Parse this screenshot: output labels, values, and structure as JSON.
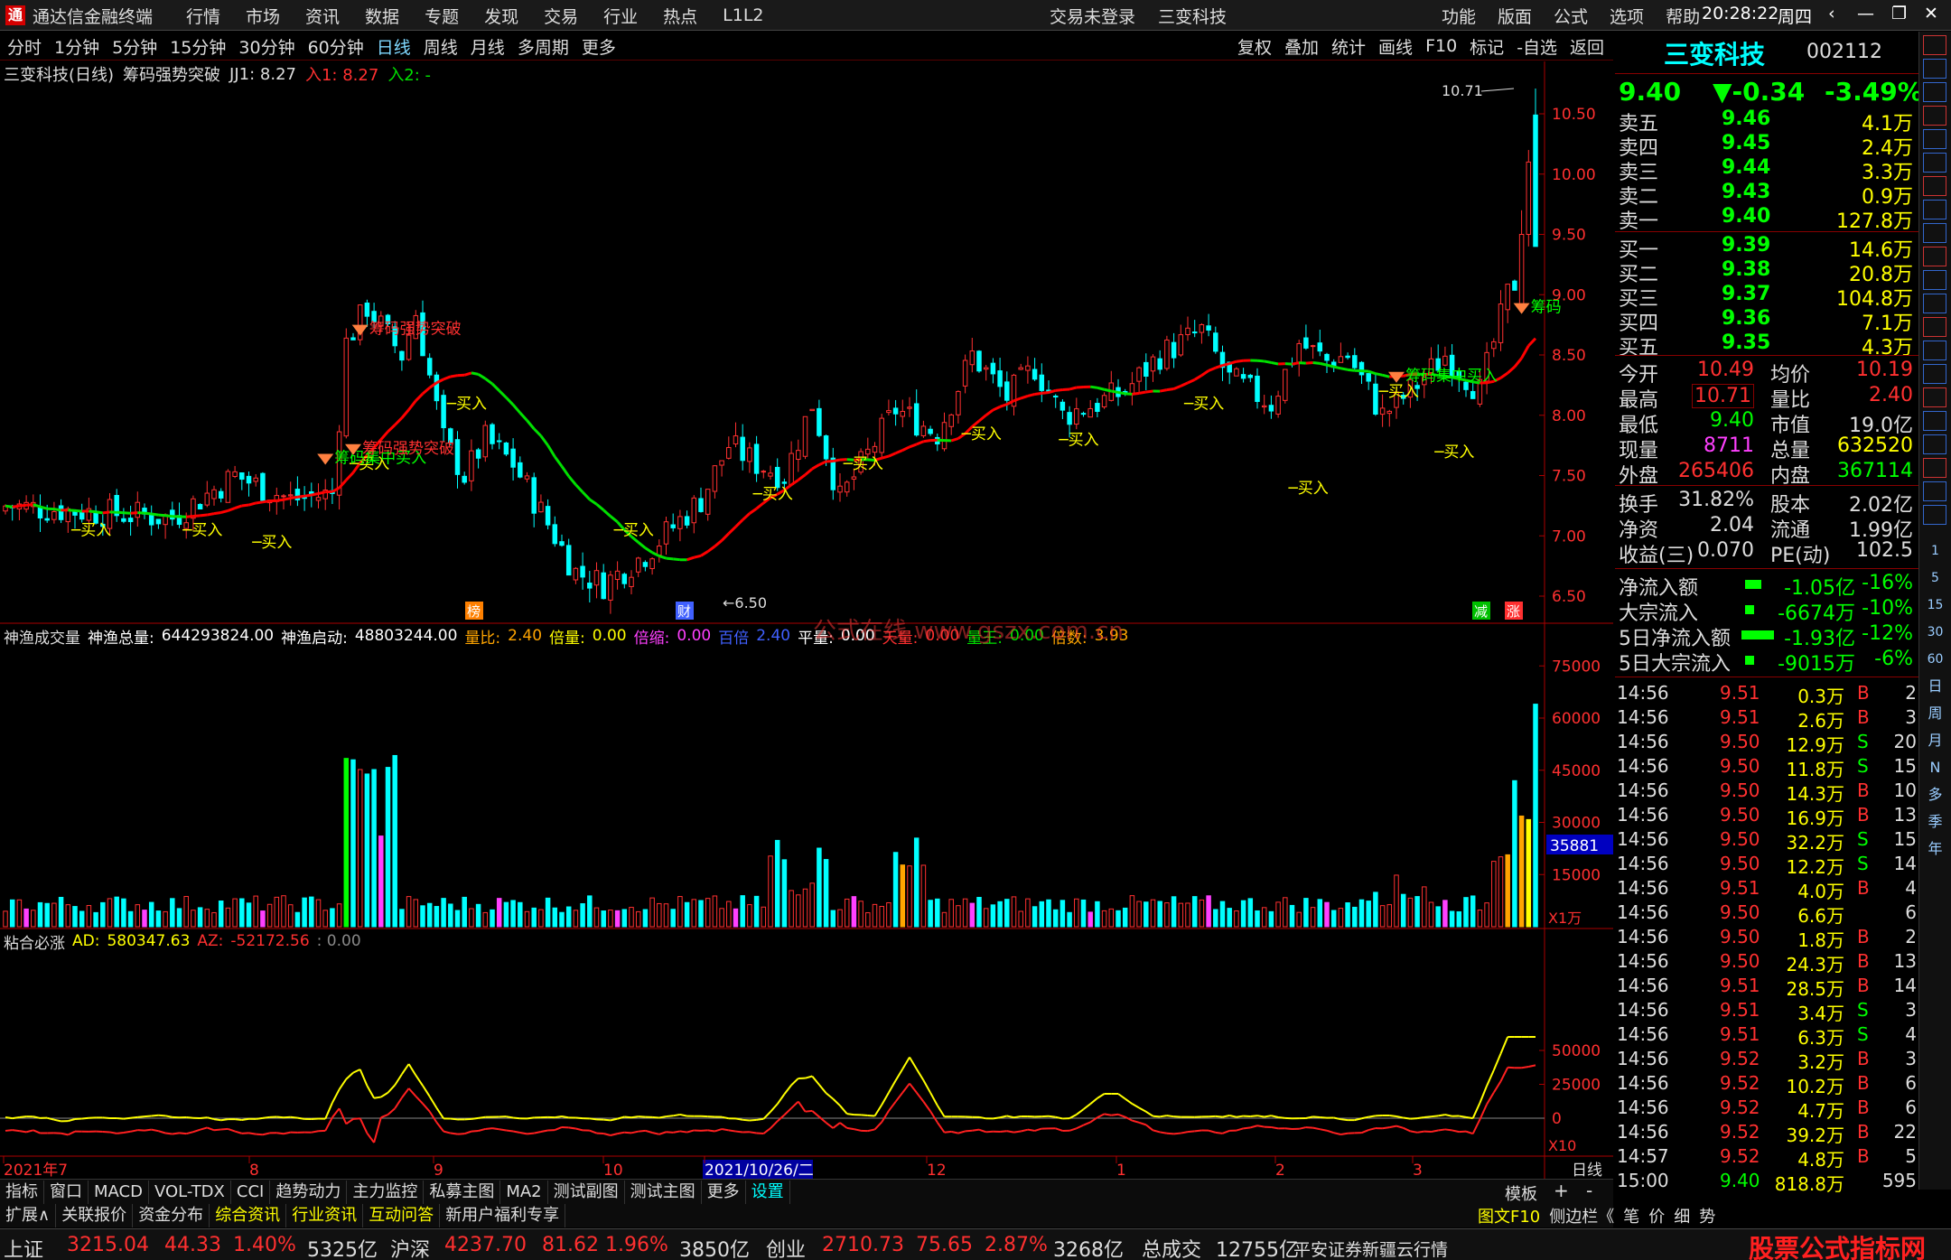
{
  "titlebar": {
    "app": "通达信金融终端",
    "menu": [
      "行情",
      "市场",
      "资讯",
      "数据",
      "专题",
      "发现",
      "交易",
      "行业",
      "热点",
      "L1L2"
    ],
    "center": [
      "交易未登录",
      "三变科技"
    ],
    "right": [
      "功能",
      "版面",
      "公式",
      "选项",
      "帮助"
    ],
    "time": "20:28:22",
    "weekday": "周四"
  },
  "periods": [
    "分时",
    "1分钟",
    "5分钟",
    "15分钟",
    "30分钟",
    "60分钟",
    "日线",
    "周线",
    "月线",
    "多周期",
    "更多"
  ],
  "active_period": "日线",
  "toolbar": [
    "复权",
    "叠加",
    "统计",
    "画线",
    "F10",
    "标记",
    "-自选",
    "返回"
  ],
  "main": {
    "title": "三变科技(日线)",
    "indicator": "筹码强势突破",
    "jj1": "JJ1: 8.27",
    "in1": "入1: 8.27",
    "in2": "入2: -",
    "high_label": "10.71",
    "low_label": "6.50",
    "yticks": [
      "10.50",
      "10.00",
      "9.50",
      "9.00",
      "8.50",
      "8.00",
      "7.50",
      "7.00",
      "6.50"
    ],
    "markers": {
      "bang": "榜",
      "cai": "财",
      "jian": "减",
      "zhang": "涨"
    },
    "labels": [
      "买入",
      "筹码强势突破",
      "筹码集中买入",
      "筹码集中买入",
      "筹码"
    ]
  },
  "vol": {
    "title": "神渔成交量",
    "total_label": "神渔总量:",
    "total": "644293824.00",
    "start_label": "神渔启动:",
    "start": "48803244.00",
    "ratio_label": "量比:",
    "ratio": "2.40",
    "bei_label": "倍量:",
    "bei": "0.00",
    "suo_label": "倍缩:",
    "suo": "0.00",
    "zhi_label": "百倍",
    "zhi": "2.40",
    "ping_label": "平量:",
    "ping": "0.00",
    "tian_label": "天量:",
    "tian": "0.00",
    "wang_label": "量王:",
    "wang": "0.00",
    "beishu_label": "倍数:",
    "beishu": "3.93",
    "yticks": [
      "75000",
      "60000",
      "45000",
      "30000",
      "15000"
    ],
    "cursor_value": "35881",
    "unit": "X1万",
    "watermark": "公式在线 www.gszx.com.cn"
  },
  "osc": {
    "title": "粘合必涨",
    "ad_label": "AD:",
    "ad": "580347.63",
    "az_label": "AZ:",
    "az": "-52172.56",
    "zero_label": ": 0.00",
    "yticks": [
      "50000",
      "25000",
      "0"
    ],
    "unit": "X10"
  },
  "xaxis": {
    "labels": [
      "2021年7",
      "8",
      "9",
      "10",
      "2021/10/26/二",
      "12",
      "1",
      "2",
      "3"
    ],
    "right": "日线"
  },
  "tabs1": [
    "指标",
    "窗口",
    "MACD",
    "VOL-TDX",
    "CCI",
    "趋势动力",
    "主力监控",
    "私募主图",
    "MA2",
    "测试副图",
    "测试主图",
    "更多",
    "设置"
  ],
  "tabs1_right": "模板",
  "tabs2": [
    "扩展∧",
    "关联报价",
    "资金分布",
    "综合资讯",
    "行业资讯",
    "互动问答",
    "新用户福利专享"
  ],
  "tabs2_right": [
    "图文F10",
    "侧边栏《",
    "笔",
    "价",
    "细",
    "势"
  ],
  "quote": {
    "name": "三变科技",
    "code": "002112",
    "price": "9.40",
    "change": "▼-0.34",
    "pct": "-3.49%",
    "sells": [
      [
        "卖五",
        "9.46",
        "4.1万"
      ],
      [
        "卖四",
        "9.45",
        "2.4万"
      ],
      [
        "卖三",
        "9.44",
        "3.3万"
      ],
      [
        "卖二",
        "9.43",
        "0.9万"
      ],
      [
        "卖一",
        "9.40",
        "127.8万"
      ]
    ],
    "buys": [
      [
        "买一",
        "9.39",
        "14.6万"
      ],
      [
        "买二",
        "9.38",
        "20.8万"
      ],
      [
        "买三",
        "9.37",
        "104.8万"
      ],
      [
        "买四",
        "9.36",
        "7.1万"
      ],
      [
        "买五",
        "9.35",
        "4.3万"
      ]
    ],
    "stats": [
      [
        "今开",
        "10.49",
        "均价",
        "10.19"
      ],
      [
        "最高",
        "10.71",
        "量比",
        "2.40"
      ],
      [
        "最低",
        "9.40",
        "市值",
        "19.0亿"
      ],
      [
        "现量",
        "8711",
        "总量",
        "632520"
      ],
      [
        "外盘",
        "265406",
        "内盘",
        "367114"
      ],
      [
        "换手",
        "31.82%",
        "股本",
        "2.02亿"
      ],
      [
        "净资",
        "2.04",
        "流通",
        "1.99亿"
      ],
      [
        "收益(三)",
        "0.070",
        "PE(动)",
        "102.5"
      ]
    ],
    "flows": [
      [
        "净流入额",
        "-1.05亿",
        "-16%"
      ],
      [
        "大宗流入",
        "-6674万",
        "-10%"
      ],
      [
        "5日净流入额",
        "-1.93亿",
        "-12%"
      ],
      [
        "5日大宗流入",
        "-9015万",
        "-6%"
      ]
    ],
    "ticks": [
      [
        "14:56",
        "9.51",
        "0.3万",
        "B",
        "2"
      ],
      [
        "14:56",
        "9.51",
        "2.6万",
        "B",
        "3"
      ],
      [
        "14:56",
        "9.50",
        "12.9万",
        "S",
        "20"
      ],
      [
        "14:56",
        "9.50",
        "11.8万",
        "S",
        "15"
      ],
      [
        "14:56",
        "9.50",
        "14.3万",
        "B",
        "10"
      ],
      [
        "14:56",
        "9.50",
        "16.9万",
        "B",
        "13"
      ],
      [
        "14:56",
        "9.50",
        "32.2万",
        "S",
        "15"
      ],
      [
        "14:56",
        "9.50",
        "12.2万",
        "S",
        "14"
      ],
      [
        "14:56",
        "9.51",
        "4.0万",
        "B",
        "4"
      ],
      [
        "14:56",
        "9.50",
        "6.6万",
        "",
        "6"
      ],
      [
        "14:56",
        "9.50",
        "1.8万",
        "B",
        "2"
      ],
      [
        "14:56",
        "9.50",
        "24.3万",
        "B",
        "13"
      ],
      [
        "14:56",
        "9.51",
        "28.5万",
        "B",
        "14"
      ],
      [
        "14:56",
        "9.51",
        "3.4万",
        "S",
        "3"
      ],
      [
        "14:56",
        "9.51",
        "6.3万",
        "S",
        "4"
      ],
      [
        "14:56",
        "9.52",
        "3.2万",
        "B",
        "3"
      ],
      [
        "14:56",
        "9.52",
        "10.2万",
        "B",
        "6"
      ],
      [
        "14:56",
        "9.52",
        "4.7万",
        "B",
        "6"
      ],
      [
        "14:56",
        "9.52",
        "39.2万",
        "B",
        "22"
      ],
      [
        "14:57",
        "9.52",
        "4.8万",
        "B",
        "5"
      ],
      [
        "15:00",
        "9.40",
        "818.8万",
        "",
        "595"
      ]
    ]
  },
  "sidetools": [
    "日",
    "周",
    "月",
    "N",
    "多",
    "季",
    "年"
  ],
  "status": {
    "sh": "上证",
    "sh_v": "3215.04",
    "sh_c": "44.33",
    "sh_p": "1.40%",
    "sh_a": "5325亿",
    "sz": "沪深",
    "sz_v": "4237.70",
    "sz_c": "81.62",
    "sz_p": "1.96%",
    "sz_a": "3850亿",
    "cy": "创业",
    "cy_v": "2710.73",
    "cy_c": "75.65",
    "cy_p": "2.87%",
    "cy_a": "3268亿",
    "total_label": "总成交",
    "total": "12755亿",
    "feed": "平安证券新疆云行情",
    "brand": "股票公式指标网",
    "brand_url": "www.gszx.com.cn"
  },
  "colors": {
    "up": "#ff3030",
    "down": "#00ffff",
    "ma_up": "#ff0000",
    "ma_down": "#00e000",
    "yellow": "#ffff00",
    "orange": "#ffa500",
    "magenta": "#ff40ff"
  }
}
